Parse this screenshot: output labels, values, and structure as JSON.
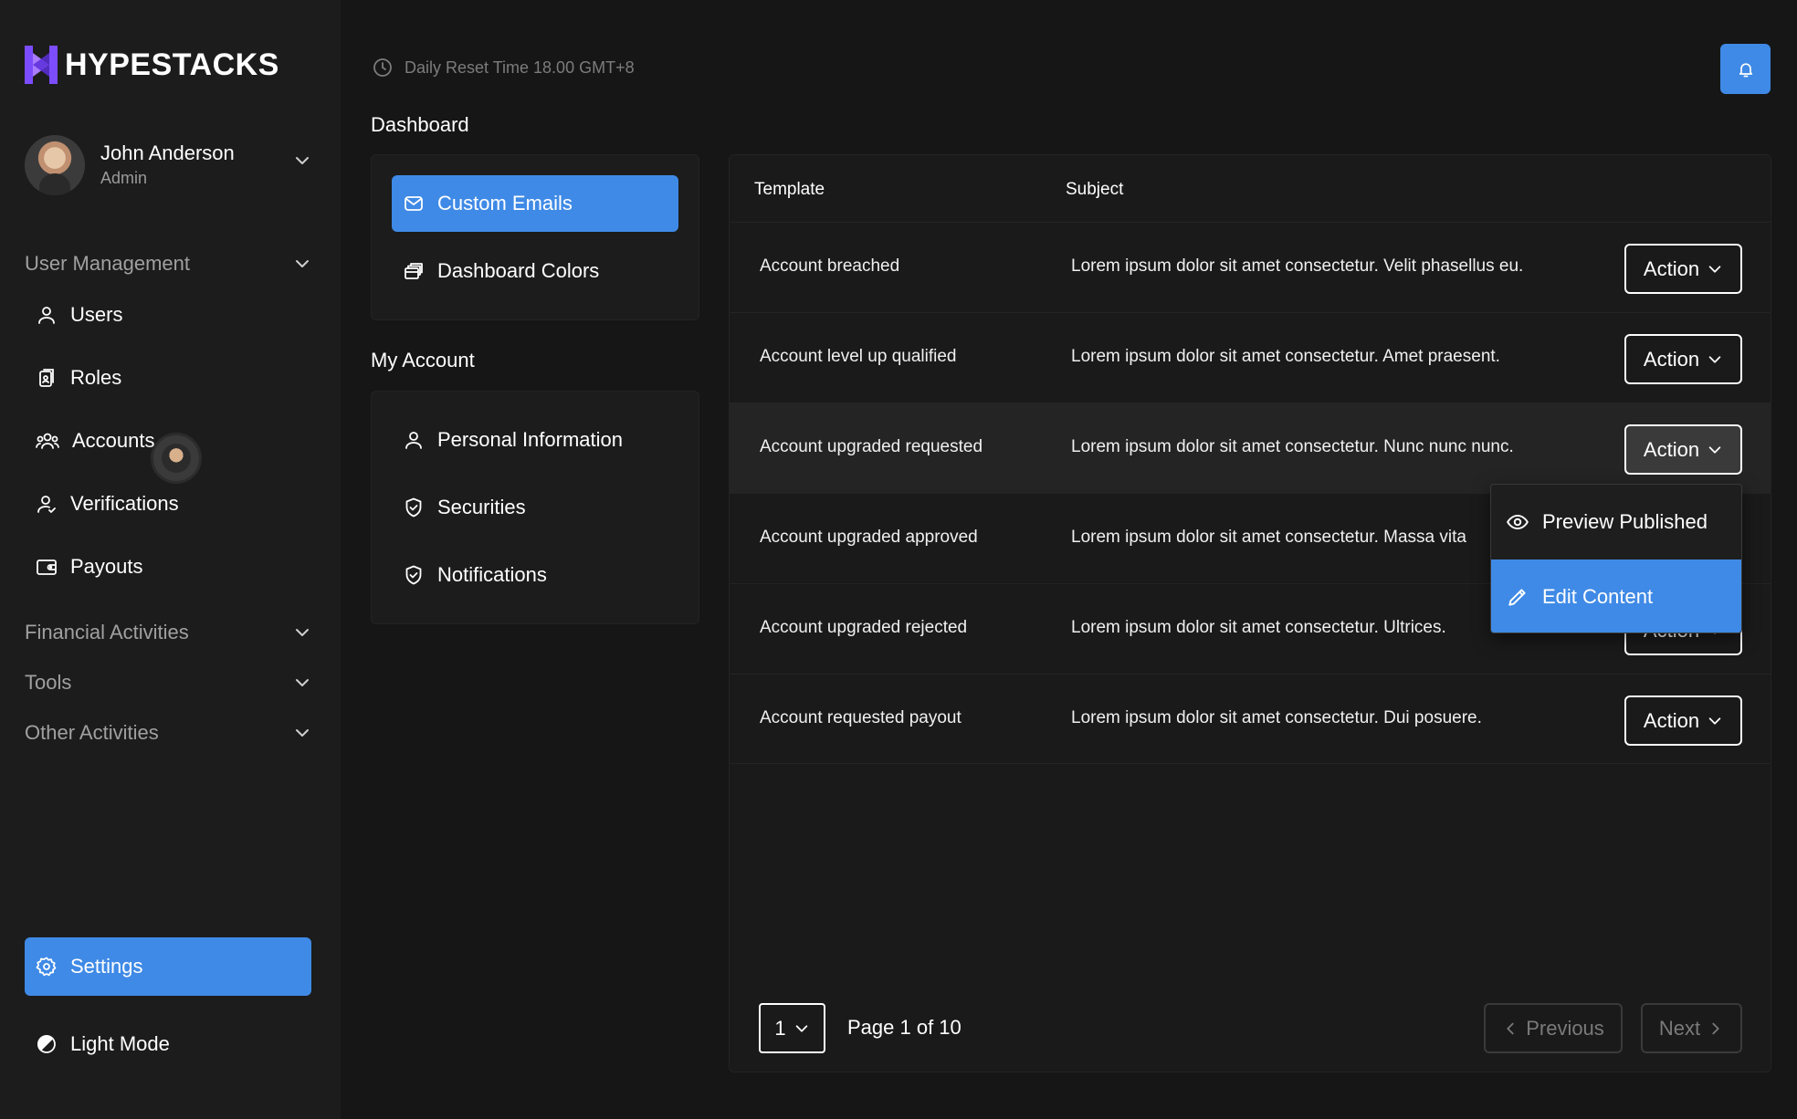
{
  "brand": {
    "name": "HYPESTACKS",
    "logo_color": "#7c4dff"
  },
  "user": {
    "name": "John Anderson",
    "role": "Admin"
  },
  "sidebar": {
    "user_management_label": "User Management",
    "items": [
      {
        "label": "Users",
        "icon": "user-icon"
      },
      {
        "label": "Roles",
        "icon": "roles-icon"
      },
      {
        "label": "Accounts",
        "icon": "accounts-icon"
      },
      {
        "label": "Verifications",
        "icon": "verification-icon"
      },
      {
        "label": "Payouts",
        "icon": "wallet-icon"
      }
    ],
    "sections": [
      {
        "label": "Financial Activities"
      },
      {
        "label": "Tools"
      },
      {
        "label": "Other Activities"
      }
    ],
    "settings_label": "Settings",
    "light_mode_label": "Light Mode"
  },
  "topbar": {
    "reset_text": "Daily Reset Time 18.00 GMT+8"
  },
  "dashboard": {
    "title": "Dashboard",
    "items": [
      {
        "label": "Custom Emails",
        "active": true
      },
      {
        "label": "Dashboard Colors",
        "active": false
      }
    ]
  },
  "my_account": {
    "title": "My Account",
    "items": [
      {
        "label": "Personal Information"
      },
      {
        "label": "Securities"
      },
      {
        "label": "Notifications"
      }
    ]
  },
  "table": {
    "columns": [
      "Template",
      "Subject"
    ],
    "action_label": "Action",
    "rows": [
      {
        "template": "Account breached",
        "subject": "Lorem ipsum dolor sit amet consectetur. Velit phasellus eu."
      },
      {
        "template": "Account level up qualified",
        "subject": "Lorem ipsum dolor sit amet consectetur. Amet praesent."
      },
      {
        "template": "Account upgraded requested",
        "subject": "Lorem ipsum dolor sit amet consectetur. Nunc nunc nunc."
      },
      {
        "template": "Account upgraded approved",
        "subject": "Lorem ipsum dolor sit amet consectetur. Massa vita"
      },
      {
        "template": "Account upgraded rejected",
        "subject": "Lorem ipsum dolor sit amet consectetur. Ultrices."
      },
      {
        "template": "Account requested payout",
        "subject": "Lorem ipsum dolor sit amet consectetur. Dui posuere."
      }
    ],
    "dropdown": {
      "items": [
        {
          "label": "Preview Published",
          "icon": "eye-icon"
        },
        {
          "label": "Edit Content",
          "icon": "pencil-icon"
        }
      ]
    }
  },
  "pagination": {
    "page_size": "1",
    "page_text": "Page 1 of 10",
    "previous_label": "Previous",
    "next_label": "Next"
  },
  "colors": {
    "accent": "#3f8ae6",
    "background": "#161616",
    "sidebar": "#1c1c1c"
  }
}
